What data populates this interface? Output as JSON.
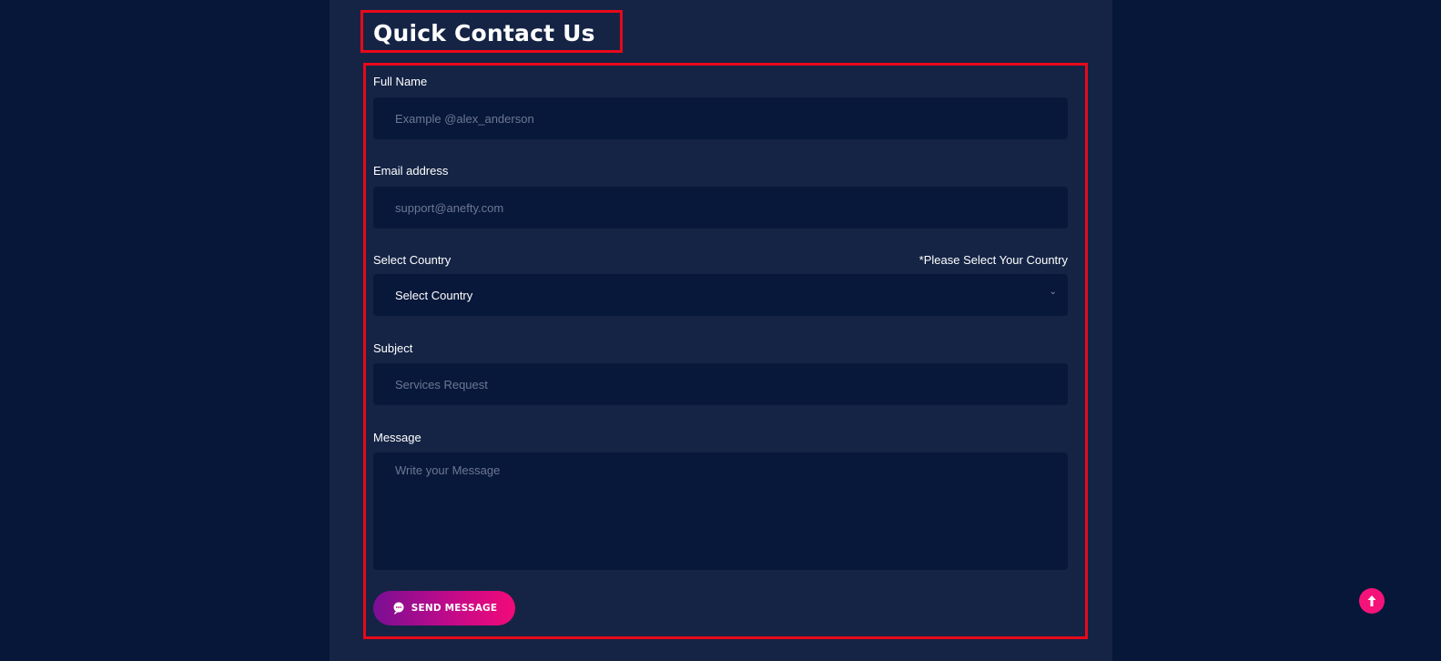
{
  "header": {
    "title": "Quick Contact Us"
  },
  "form": {
    "full_name": {
      "label": "Full Name",
      "placeholder": "Example @alex_anderson",
      "value": ""
    },
    "email": {
      "label": "Email address",
      "placeholder": "support@anefty.com",
      "value": ""
    },
    "country": {
      "label": "Select Country",
      "note": "*Please Select Your Country",
      "selected": "Select Country"
    },
    "subject": {
      "label": "Subject",
      "placeholder": "Services Request",
      "value": ""
    },
    "message": {
      "label": "Message",
      "placeholder": "Write your Message",
      "value": ""
    },
    "send_button": {
      "label": "SEND MESSAGE",
      "icon": "chat-send-icon"
    }
  },
  "scroll_top": {
    "icon": "arrow-up-icon"
  },
  "colors": {
    "page_bg": "#071739",
    "panel_bg": "#152445",
    "field_bg": "#08183a",
    "highlight_border": "#e8091a",
    "accent_pink": "#f5137a",
    "accent_purple": "#7a0f93"
  }
}
